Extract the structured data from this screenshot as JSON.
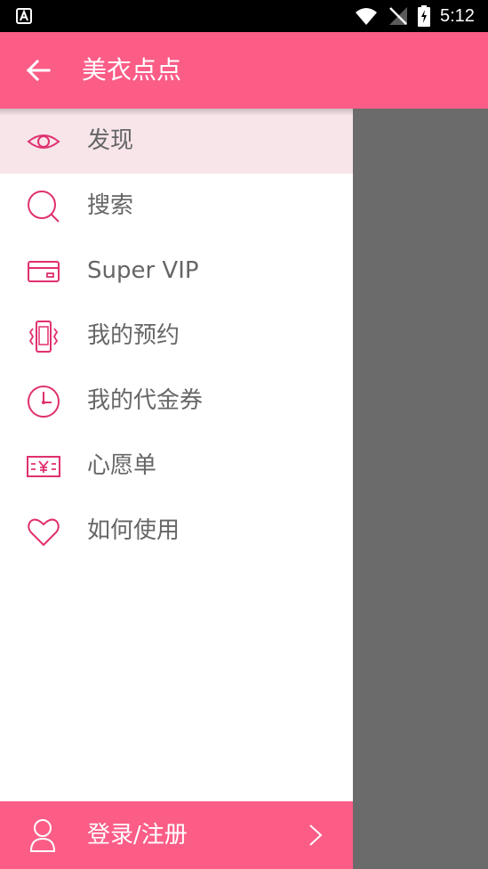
{
  "status_bar": {
    "time": "5:12",
    "icons": [
      "notification-a-icon",
      "wifi-icon",
      "signal-off-icon",
      "battery-charging-icon"
    ]
  },
  "app_bar": {
    "title": "美衣点点",
    "back_icon": "arrow-left-icon"
  },
  "colors": {
    "accent": "#fb5d87",
    "icon_pink": "#e0306f",
    "selected_bg": "#f7e5ea",
    "scrim": "#6b6b6b",
    "label_gray": "#666666"
  },
  "menu": {
    "items": [
      {
        "label": "发现",
        "icon": "eye-icon",
        "selected": true
      },
      {
        "label": "搜索",
        "icon": "search-icon",
        "selected": false
      },
      {
        "label": "Super VIP",
        "icon": "card-icon",
        "selected": false
      },
      {
        "label": "我的预约",
        "icon": "phone-vibrate-icon",
        "selected": false
      },
      {
        "label": "我的代金券",
        "icon": "clock-icon",
        "selected": false
      },
      {
        "label": "心愿单",
        "icon": "yen-ticket-icon",
        "selected": false
      },
      {
        "label": "如何使用",
        "icon": "heart-icon",
        "selected": false
      }
    ]
  },
  "login": {
    "label": "登录/注册",
    "icon": "user-icon",
    "chevron": "chevron-right-icon"
  }
}
